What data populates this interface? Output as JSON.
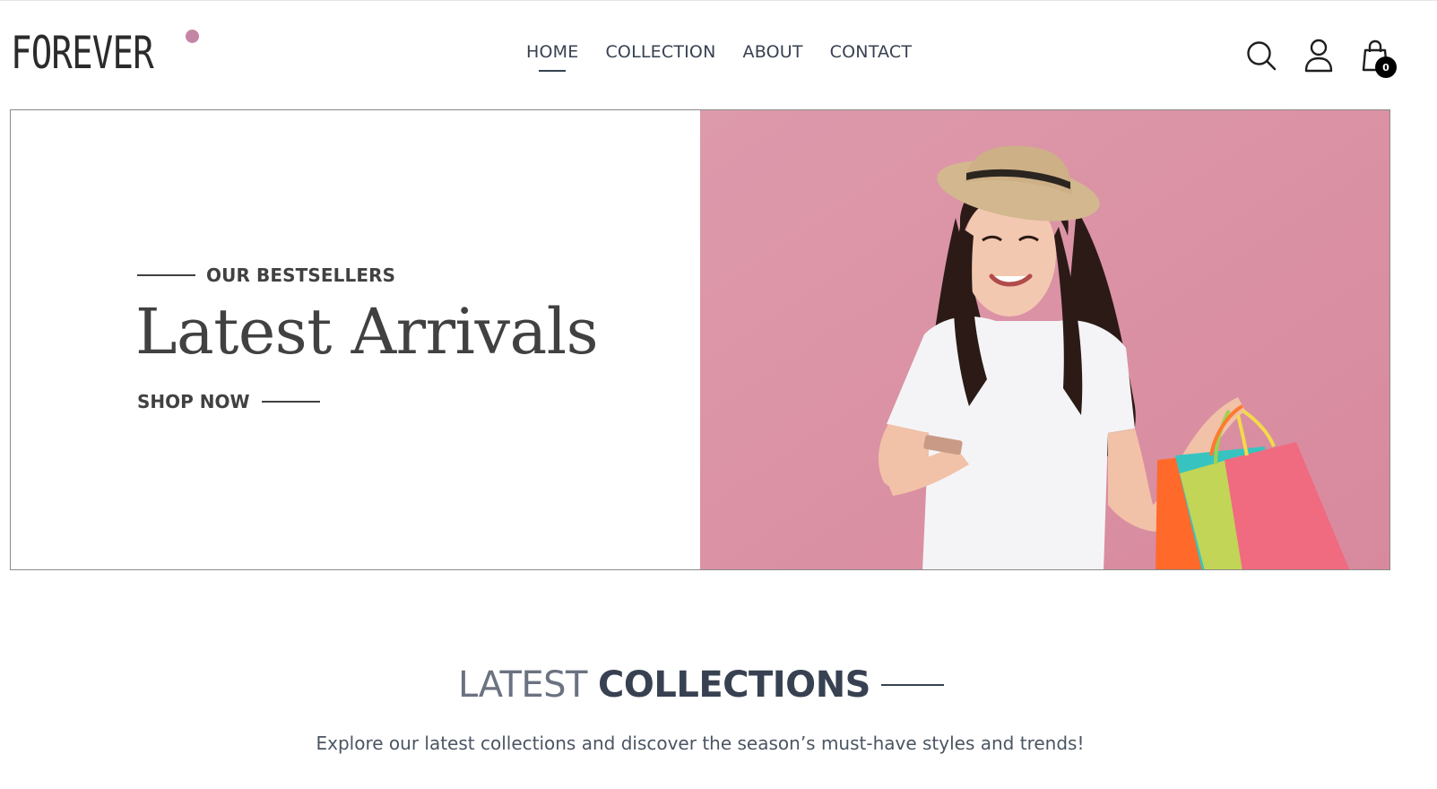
{
  "brand": {
    "name": "FOREVER",
    "dot_color": "#c586a5"
  },
  "nav": {
    "items": [
      {
        "label": "HOME",
        "active": true
      },
      {
        "label": "COLLECTION",
        "active": false
      },
      {
        "label": "ABOUT",
        "active": false
      },
      {
        "label": "CONTACT",
        "active": false
      }
    ]
  },
  "header_icons": {
    "search": "search-icon",
    "profile": "user-icon",
    "cart": "shopping-bag-icon",
    "cart_count": "0"
  },
  "hero": {
    "kicker": "OUR BESTSELLERS",
    "title": "Latest Arrivals",
    "cta": "SHOP NOW",
    "image_description_bg": "#dc98a8"
  },
  "section": {
    "title_light": "LATEST",
    "title_bold": "COLLECTIONS",
    "subtitle": "Explore our latest collections and discover the season’s must-have styles and trends!"
  }
}
